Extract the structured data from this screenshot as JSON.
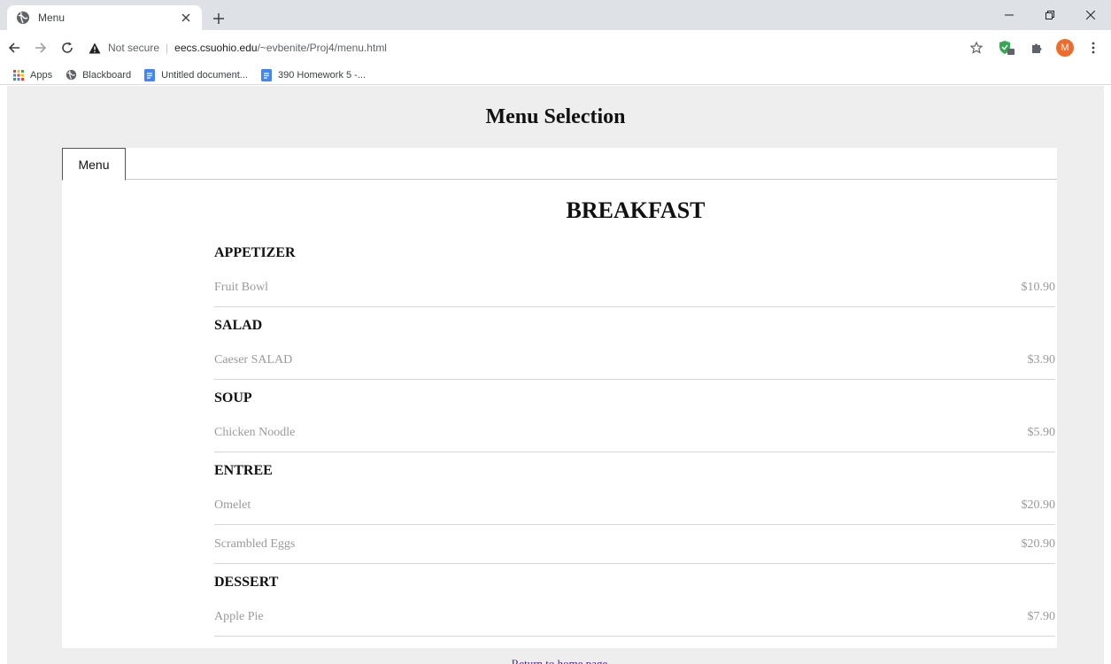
{
  "browser": {
    "tab_title": "Menu",
    "not_secure": "Not secure",
    "url_host": "eecs.csuohio.edu",
    "url_path": "/~evbenite/Proj4/menu.html",
    "profile_initial": "M",
    "bookmarks": [
      {
        "label": "Apps",
        "icon": "apps-grid-icon"
      },
      {
        "label": "Blackboard",
        "icon": "globe-icon"
      },
      {
        "label": "Untitled document...",
        "icon": "docs-icon"
      },
      {
        "label": "390 Homework 5 -...",
        "icon": "docs-icon"
      }
    ]
  },
  "page": {
    "title": "Menu Selection",
    "tab_label": "Menu",
    "meal": "BREAKFAST",
    "categories": [
      {
        "name": "APPETIZER",
        "items": [
          {
            "name": "Fruit Bowl",
            "price": "$10.90"
          }
        ]
      },
      {
        "name": "SALAD",
        "items": [
          {
            "name": "Caeser SALAD",
            "price": "$3.90"
          }
        ]
      },
      {
        "name": "SOUP",
        "items": [
          {
            "name": "Chicken Noodle",
            "price": "$5.90"
          }
        ]
      },
      {
        "name": "ENTREE",
        "items": [
          {
            "name": "Omelet",
            "price": "$20.90"
          },
          {
            "name": "Scrambled Eggs",
            "price": "$20.90"
          }
        ]
      },
      {
        "name": "DESSERT",
        "items": [
          {
            "name": "Apple Pie",
            "price": "$7.90"
          }
        ]
      }
    ],
    "return_link": "Return to home page"
  },
  "colors": {
    "page_background": "#eeeeee",
    "panel": "#ffffff",
    "price_text": "#9a9a9a",
    "visited_link": "#551a8b"
  }
}
